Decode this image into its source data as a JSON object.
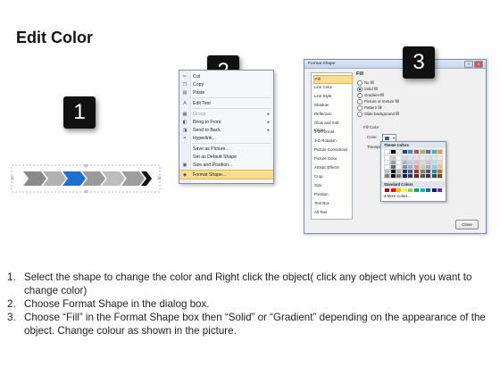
{
  "title": "Edit Color",
  "badges": [
    "1",
    "2",
    "3"
  ],
  "context_menu": {
    "items": [
      {
        "label": "Cut",
        "icon": "scissors-icon",
        "glyph": "✂"
      },
      {
        "label": "Copy",
        "icon": "copy-icon",
        "glyph": "❐"
      },
      {
        "label": "Paste",
        "icon": "paste-icon",
        "glyph": "▤"
      },
      {
        "label": "Edit Text",
        "icon": "edit-text-icon",
        "glyph": "A"
      },
      {
        "label": "Group",
        "icon": "group-icon",
        "glyph": "▦",
        "submenu": true,
        "disabled": true
      },
      {
        "label": "Bring to Front",
        "icon": "bring-front-icon",
        "glyph": "◧",
        "submenu": true
      },
      {
        "label": "Send to Back",
        "icon": "send-back-icon",
        "glyph": "◨",
        "submenu": true
      },
      {
        "label": "Hyperlink...",
        "icon": "hyperlink-icon",
        "glyph": "⚭"
      },
      {
        "label": "Save as Picture...",
        "icon": "",
        "glyph": ""
      },
      {
        "label": "Set as Default Shape",
        "icon": "",
        "glyph": ""
      },
      {
        "label": "Size and Position...",
        "icon": "size-position-icon",
        "glyph": "▣"
      },
      {
        "label": "Format Shape...",
        "icon": "format-shape-icon",
        "glyph": "◆",
        "highlighted": true
      }
    ]
  },
  "dialog": {
    "title": "Format Shape",
    "window_buttons": [
      "?",
      "X"
    ],
    "categories": [
      "Fill",
      "Line Color",
      "Line Style",
      "Shadow",
      "Reflection",
      "Glow and Soft Edges",
      "3-D Format",
      "3-D Rotation",
      "Picture Corrections",
      "Picture Color",
      "Artistic Effects",
      "Crop",
      "Size",
      "Position",
      "Text Box",
      "Alt Text"
    ],
    "selected_category": "Fill",
    "section_heading": "Fill",
    "fill_options": [
      {
        "label": "No fill",
        "checked": false
      },
      {
        "label": "Solid fill",
        "checked": true
      },
      {
        "label": "Gradient fill",
        "checked": false
      },
      {
        "label": "Picture or texture fill",
        "checked": false
      },
      {
        "label": "Pattern fill",
        "checked": false
      },
      {
        "label": "Slide background fill",
        "checked": false
      }
    ],
    "fill_color_label": "Fill Color",
    "color_label": "Color:",
    "transparency_label": "Transpa",
    "close_label": "Close",
    "selected_color": "#2b5cc4"
  },
  "color_popup": {
    "theme_header": "Theme Colors",
    "standard_header": "Standard Colors",
    "more_colors": "More Colors...",
    "theme_top": [
      "#ffffff",
      "#000000",
      "#eeece1",
      "#1f497d",
      "#4f81bd",
      "#c0504d",
      "#9bbb59",
      "#8064a2",
      "#4bacc6",
      "#f79646"
    ],
    "standard": [
      "#c00000",
      "#ff0000",
      "#ffc000",
      "#ffff00",
      "#92d050",
      "#00b050",
      "#00b0f0",
      "#0070c0",
      "#002060",
      "#7030a0"
    ]
  },
  "steps": [
    {
      "num": "1.",
      "text": "Select the shape to change the color and Right click the object( click any object which you want to change color)"
    },
    {
      "num": "2.",
      "text": "Choose Format Shape in the dialog box."
    },
    {
      "num": "3.",
      "text": "Choose “Fill” in the Format Shape box then “Solid” or “Gradient” depending on the appearance of the object. Change colour as shown in the picture."
    }
  ]
}
